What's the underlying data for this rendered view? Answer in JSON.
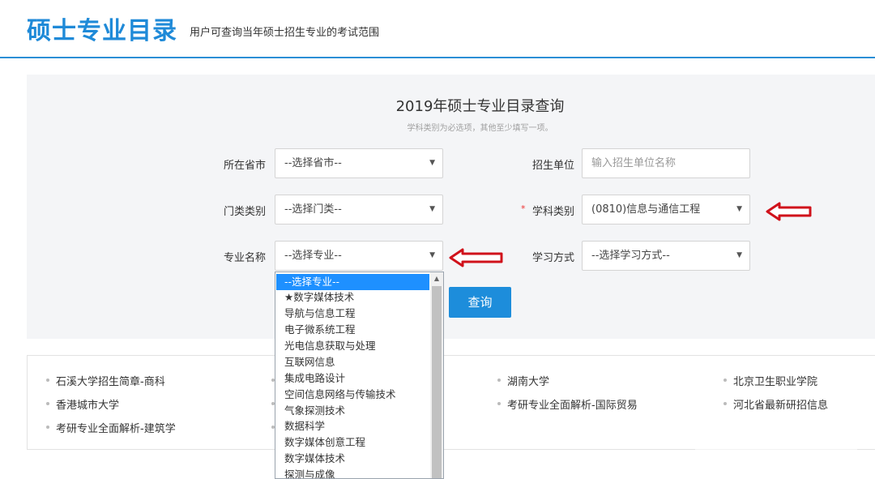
{
  "header": {
    "title": "硕士专业目录",
    "subtitle": "用户可查询当年硕士招生专业的考试范围"
  },
  "search": {
    "title": "2019年硕士专业目录查询",
    "hint": "学科类别为必选项，其他至少填写一项。",
    "province_label": "所在省市",
    "province_value": "--选择省市--",
    "unit_label": "招生单位",
    "unit_placeholder": "输入招生单位名称",
    "category_label": "门类类别",
    "category_value": "--选择门类--",
    "discipline_required": "*",
    "discipline_label": "学科类别",
    "discipline_value": "(0810)信息与通信工程",
    "major_label": "专业名称",
    "major_value": "--选择专业--",
    "study_label": "学习方式",
    "study_value": "--选择学习方式--",
    "query_button": "查询",
    "caret": "▼"
  },
  "dropdown": {
    "items": [
      "--选择专业--",
      "★数字媒体技术",
      "导航与信息工程",
      "电子微系统工程",
      "光电信息获取与处理",
      "互联网信息",
      "集成电路设计",
      "空间信息网络与传输技术",
      "气象探测技术",
      "数据科学",
      "数字媒体创意工程",
      "数字媒体技术",
      "探测与成像"
    ],
    "scroll_up": "▲"
  },
  "links": {
    "col1": [
      "石溪大学招生简章-商科",
      "香港城市大学",
      "考研专业全面解析-建筑学"
    ],
    "col3": [
      "湖南大学",
      "考研专业全面解析-国际贸易"
    ],
    "col4": [
      "北京卫生职业学院",
      "河北省最新研招信息"
    ]
  },
  "colors": {
    "accent": "#1f8ad8",
    "button": "#1d8ddb",
    "arrow": "#d0121b",
    "selected": "#1e90ff"
  }
}
